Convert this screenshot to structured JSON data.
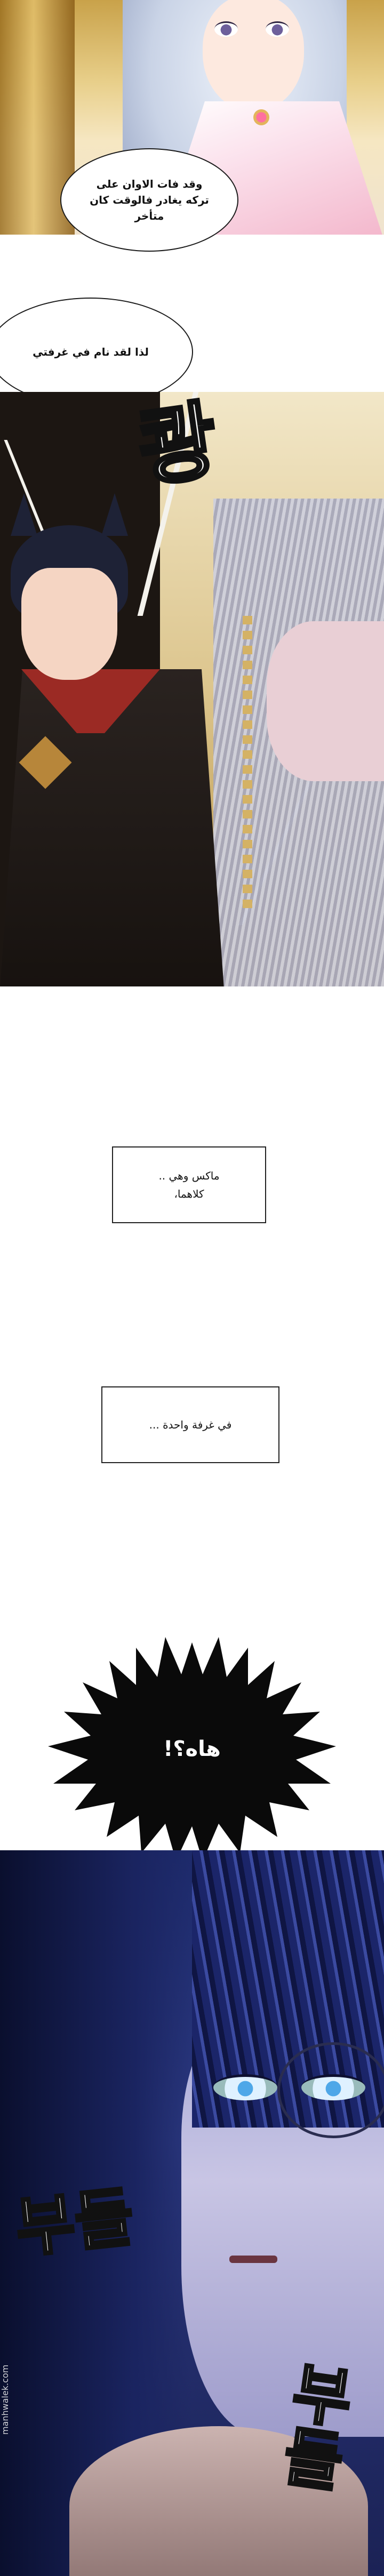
{
  "bubbles": {
    "time_late": "وقد فات الاوان على تركه يغادر فالوقت كان متأخر",
    "slept_in_room": "لذا لقد نام في غرفتي"
  },
  "sfx": {
    "shock_top": "쾅",
    "blink_left": "부들",
    "blink_right": "부들"
  },
  "captions": {
    "max_and_her_line1": "ماكس وهي ..",
    "max_and_her_line2": "كلاهما،",
    "one_room": "في غرفة واحدة ..."
  },
  "burst": {
    "text": "هاه؟!"
  },
  "watermark": {
    "text": "manhwalek.com"
  }
}
